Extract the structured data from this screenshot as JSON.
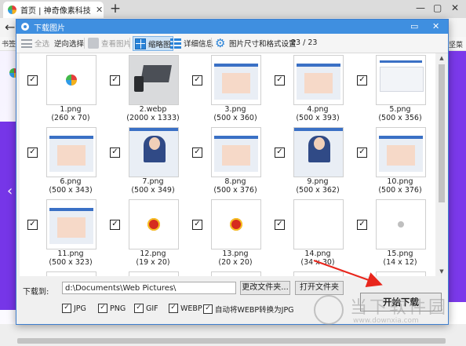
{
  "browser": {
    "tab_title": "首页 | 神奇像素科技",
    "tab_close": "✕",
    "new_tab": "+",
    "window_controls": [
      "—",
      "▢",
      "✕"
    ],
    "back": "←",
    "bookmarks_label": "书签:",
    "bookmarks_right": "坚菜单"
  },
  "dialog": {
    "title": "下载图片",
    "controls": [
      "▭",
      "✕"
    ],
    "toolbar": {
      "select_all": "全选",
      "invert": "逆向选择",
      "view_image": "查看图片",
      "thumbnails": "缩略图",
      "details": "详细信息",
      "size_format": "图片尺寸和格式设置",
      "count": "23 / 23"
    },
    "images": [
      {
        "name": "1.png",
        "size": "(260 x 70)",
        "checked": true,
        "art": "logo"
      },
      {
        "name": "2.webp",
        "size": "(2000 x 1333)",
        "checked": true,
        "art": "laptop"
      },
      {
        "name": "3.png",
        "size": "(500 x 360)",
        "checked": true,
        "art": "screen"
      },
      {
        "name": "4.png",
        "size": "(500 x 393)",
        "checked": true,
        "art": "screen"
      },
      {
        "name": "5.png",
        "size": "(500 x 356)",
        "checked": true,
        "art": "web"
      },
      {
        "name": "6.png",
        "size": "(500 x 343)",
        "checked": true,
        "art": "screen"
      },
      {
        "name": "7.png",
        "size": "(500 x 349)",
        "checked": true,
        "art": "person"
      },
      {
        "name": "8.png",
        "size": "(500 x 376)",
        "checked": true,
        "art": "screen"
      },
      {
        "name": "9.png",
        "size": "(500 x 362)",
        "checked": true,
        "art": "person"
      },
      {
        "name": "10.png",
        "size": "(500 x 376)",
        "checked": true,
        "art": "screen"
      },
      {
        "name": "11.png",
        "size": "(500 x 323)",
        "checked": true,
        "art": "screen"
      },
      {
        "name": "12.png",
        "size": "(19 x 20)",
        "checked": true,
        "art": "emblem"
      },
      {
        "name": "13.png",
        "size": "(20 x 20)",
        "checked": true,
        "art": "emblem"
      },
      {
        "name": "14.png",
        "size": "(34 x 30)",
        "checked": true,
        "art": "blank"
      },
      {
        "name": "15.png",
        "size": "(14 x 12)",
        "checked": true,
        "art": "user"
      }
    ],
    "bottom": {
      "download_to_label": "下载到:",
      "path": "d:\\Documents\\Web Pictures\\",
      "change_folder": "更改文件夹...",
      "open_folder": "打开文件夹",
      "formats": [
        {
          "label": "JPG",
          "checked": true
        },
        {
          "label": "PNG",
          "checked": true
        },
        {
          "label": "GIF",
          "checked": true
        },
        {
          "label": "WEBP",
          "checked": true
        },
        {
          "label": "自动将WEBP转换为JPG",
          "checked": true
        }
      ]
    }
  },
  "start_download": "开始下载",
  "watermark": {
    "text": "当下软件园",
    "url": "www.downxia.com"
  },
  "colors": {
    "dialog_title_bg": "#3f8fe0",
    "page_accent": "#7636e8",
    "annotation_arrow": "#e8261c"
  },
  "icons": {
    "select_all": "checklist-icon",
    "view_image": "image-view-icon",
    "thumbnails": "thumbnail-grid-icon",
    "details": "detail-list-icon",
    "size_format": "gear-icon",
    "check": "✓"
  }
}
